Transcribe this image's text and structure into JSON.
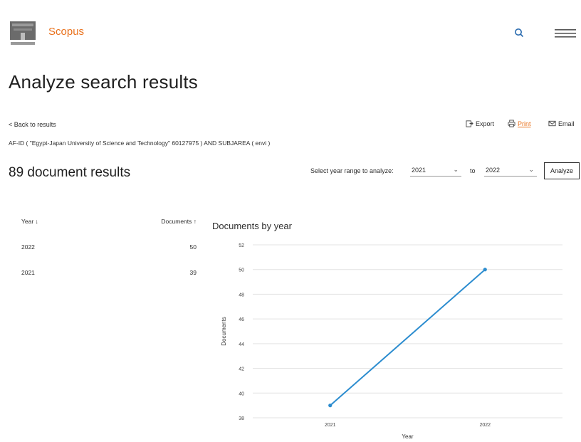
{
  "header": {
    "brand": "Scopus",
    "logo_icon": "elsevier-tree-logo",
    "search_icon": "search-icon",
    "menu_icon": "hamburger-menu-icon"
  },
  "page": {
    "title": "Analyze search results",
    "back_link": "< Back to results",
    "actions": {
      "export": "Export",
      "print": "Print",
      "email": "Email"
    },
    "query": "AF-ID ( \"Egypt-Japan University of Science and Technology\" 60127975 ) AND SUBJAREA ( envi )",
    "results_count": "89 document results"
  },
  "year_range": {
    "label": "Select year range to analyze:",
    "from": "2021",
    "to_label": "to",
    "to": "2022",
    "analyze_button": "Analyze"
  },
  "table": {
    "headers": {
      "year": "Year ↓",
      "documents": "Documents ↑"
    },
    "rows": [
      {
        "year": "2022",
        "documents": "50"
      },
      {
        "year": "2021",
        "documents": "39"
      }
    ]
  },
  "colors": {
    "brand": "#e9711c",
    "line": "#2b8ccf"
  },
  "chart_data": {
    "type": "line",
    "title": "Documents by year",
    "xlabel": "Year",
    "ylabel": "Documents",
    "categories": [
      "2021",
      "2022"
    ],
    "series": [
      {
        "values": [
          39,
          50
        ]
      }
    ],
    "ylim": [
      38,
      52
    ],
    "yticks": [
      38,
      40,
      42,
      44,
      46,
      48,
      50,
      52
    ],
    "grid": true
  }
}
